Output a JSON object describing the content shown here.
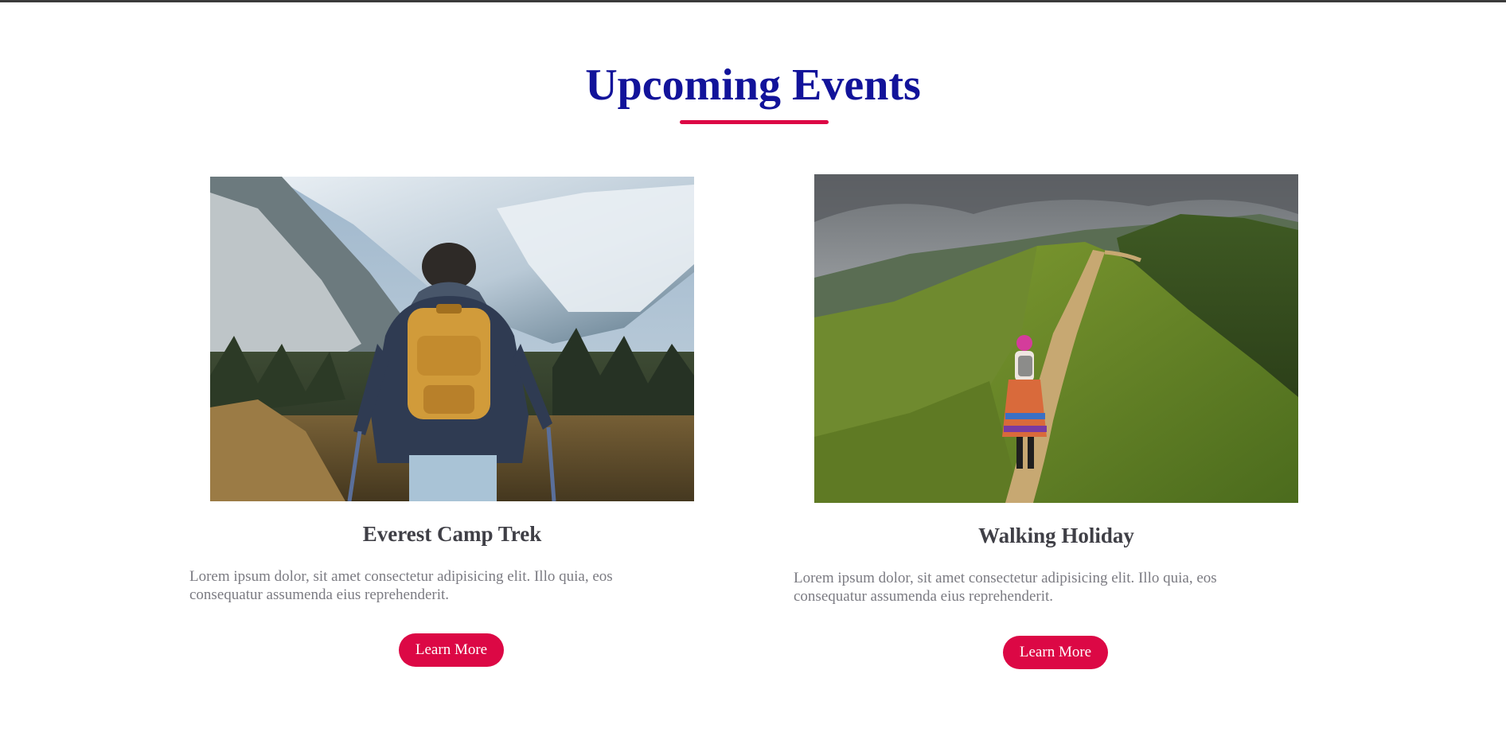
{
  "section": {
    "title": "Upcoming Events",
    "accent_color": "#dc0845",
    "title_color": "#12139a"
  },
  "events": [
    {
      "title": "Everest Camp Trek",
      "description": "Lorem ipsum dolor, sit amet consectetur adipisicing elit. Illo quia, eos consequatur assumenda eius reprehenderit.",
      "button_label": "Learn More",
      "image_subject": "hiker with orange backpack and trekking poles facing snowy mountains"
    },
    {
      "title": "Walking Holiday",
      "description": "Lorem ipsum dolor, sit amet consectetur adipisicing elit. Illo quia, eos consequatur assumenda eius reprehenderit.",
      "button_label": "Learn More",
      "image_subject": "woman walking along a trail on a green mountain ridge"
    }
  ]
}
